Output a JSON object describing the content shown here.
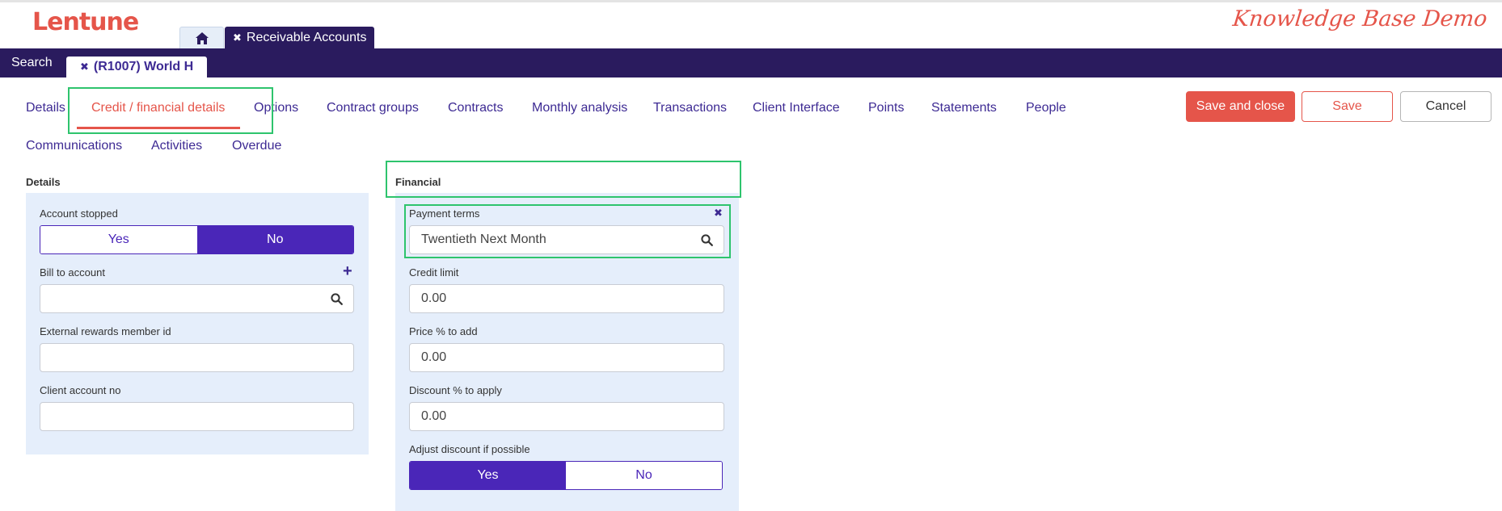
{
  "header": {
    "logo": "Lentune",
    "kb_demo": "Knowledge Base Demo",
    "app_tab_label": "Receivable Accounts",
    "close_glyph": "✖"
  },
  "navbar": {
    "search_label": "Search",
    "record_tab_label": "(R1007) World H"
  },
  "subtabs": [
    "Details",
    "Credit / financial details",
    "Options",
    "Contract groups",
    "Contracts",
    "Monthly analysis",
    "Transactions",
    "Client Interface",
    "Points",
    "Statements",
    "People",
    "Communications",
    "Activities",
    "Overdue"
  ],
  "active_subtab": "Credit / financial details",
  "actions": {
    "save_close": "Save and close",
    "save": "Save",
    "cancel": "Cancel"
  },
  "details": {
    "title": "Details",
    "account_stopped": {
      "label": "Account stopped",
      "yes": "Yes",
      "no": "No",
      "selected": "No"
    },
    "bill_to_account": {
      "label": "Bill to account",
      "value": ""
    },
    "external_rewards": {
      "label": "External rewards member id",
      "value": ""
    },
    "client_account_no": {
      "label": "Client account no",
      "value": ""
    }
  },
  "financial": {
    "title": "Financial",
    "payment_terms": {
      "label": "Payment terms",
      "value": "Twentieth Next Month"
    },
    "credit_limit": {
      "label": "Credit limit",
      "value": "0.00"
    },
    "price_pct": {
      "label": "Price % to add",
      "value": "0.00"
    },
    "discount_pct": {
      "label": "Discount % to apply",
      "value": "0.00"
    },
    "adjust_discount": {
      "label": "Adjust discount if possible",
      "yes": "Yes",
      "no": "No",
      "selected": "Yes"
    }
  },
  "colors": {
    "brand": "#e5554a",
    "nav": "#2a1b5e",
    "accent": "#4a26b8",
    "highlight": "#2ec46d",
    "panel": "#e5eefb"
  }
}
